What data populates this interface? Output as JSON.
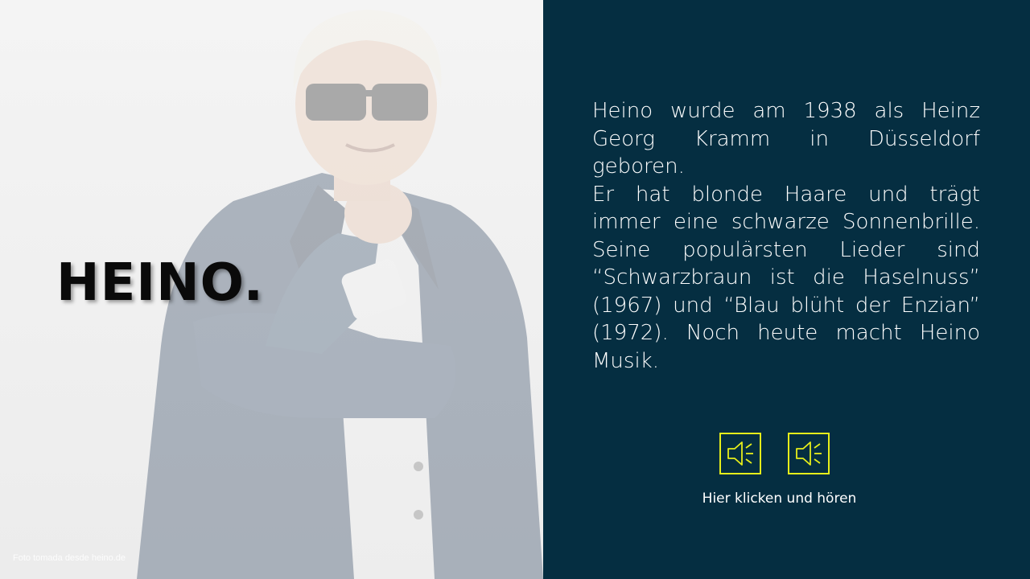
{
  "slide": {
    "title": "HEINO.",
    "photo_credit": "Foto tomada desde heino.de",
    "bio_paragraphs": [
      "Heino wurde am 1938 als Heinz Georg Kramm in Düsseldorf geboren.",
      "Er hat blonde Haare und trägt immer eine schwarze Sonnenbrille. Seine populärsten Lieder sind “Schwarzbraun ist die Haselnuss” (1967) und “Blau blüht der Enzian” (1972). Noch heute macht Heino Musik."
    ],
    "audio_caption": "Hier klicken und hören",
    "audio_buttons": [
      {
        "icon": "speaker-icon"
      },
      {
        "icon": "speaker-icon"
      }
    ]
  },
  "colors": {
    "panel_background": "#052e41",
    "accent": "#e6ee1a",
    "text_light": "#ffffff",
    "title_text": "#0a0a0a"
  }
}
